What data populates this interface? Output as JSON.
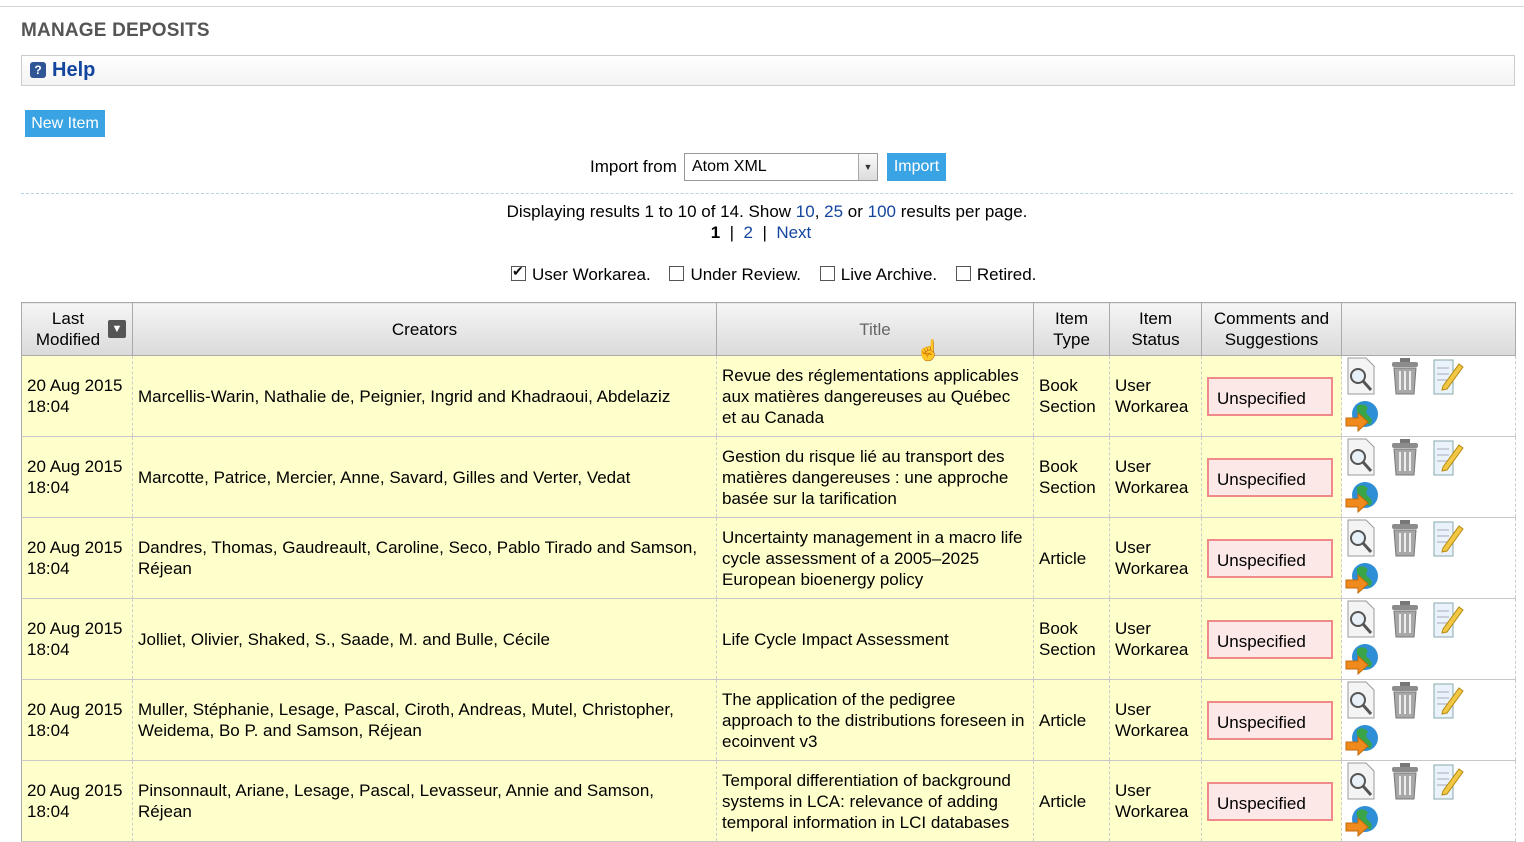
{
  "page": {
    "title": "MANAGE DEPOSITS",
    "help": "Help"
  },
  "toolbar": {
    "new_item": "New Item",
    "import_from": "Import from",
    "import_format": "Atom XML",
    "import_button": "Import"
  },
  "results": {
    "prefix": "Displaying results 1 to 10 of 14. Show ",
    "opt10": "10",
    "sep1": ", ",
    "opt25": "25",
    "sep2": " or ",
    "opt100": "100",
    "suffix": " results per page.",
    "current_page": "1",
    "page2": "2",
    "next": "Next",
    "divider": "|"
  },
  "filters": [
    {
      "label": "User Workarea.",
      "checked": true
    },
    {
      "label": "Under Review.",
      "checked": false
    },
    {
      "label": "Live Archive.",
      "checked": false
    },
    {
      "label": "Retired.",
      "checked": false
    }
  ],
  "columns": {
    "last_modified": "Last Modified",
    "creators": "Creators",
    "title": "Title",
    "item_type": "Item Type",
    "item_status": "Item Status",
    "comments": "Comments and Suggestions"
  },
  "rows": [
    {
      "date": "20 Aug 2015",
      "time": "18:04",
      "creators": "Marcellis-Warin, Nathalie de, Peignier, Ingrid and Khadraoui, Abdelaziz",
      "title": "Revue des réglementations applicables aux matières dangereuses au Québec et au Canada",
      "type": "Book Section",
      "status": "User Workarea",
      "comments": "Unspecified"
    },
    {
      "date": "20 Aug 2015",
      "time": "18:04",
      "creators": "Marcotte, Patrice, Mercier, Anne, Savard, Gilles and Verter, Vedat",
      "title": "Gestion du risque lié au transport des matières dangereuses : une approche basée sur la tarification",
      "type": "Book Section",
      "status": "User Workarea",
      "comments": "Unspecified"
    },
    {
      "date": "20 Aug 2015",
      "time": "18:04",
      "creators": "Dandres, Thomas, Gaudreault, Caroline, Seco, Pablo Tirado and Samson, Réjean",
      "title": "Uncertainty management in a macro life cycle assessment of a 2005–2025 European bioenergy policy",
      "type": "Article",
      "status": "User Workarea",
      "comments": "Unspecified"
    },
    {
      "date": "20 Aug 2015",
      "time": "18:04",
      "creators": "Jolliet, Olivier, Shaked, S., Saade, M. and Bulle, Cécile",
      "title": "Life Cycle Impact Assessment",
      "type": "Book Section",
      "status": "User Workarea",
      "comments": "Unspecified"
    },
    {
      "date": "20 Aug 2015",
      "time": "18:04",
      "creators": "Muller, Stéphanie, Lesage, Pascal, Ciroth, Andreas, Mutel, Christopher, Weidema, Bo P. and Samson, Réjean",
      "title": "The application of the pedigree approach to the distributions foreseen in ecoinvent v3",
      "type": "Article",
      "status": "User Workarea",
      "comments": "Unspecified"
    },
    {
      "date": "20 Aug 2015",
      "time": "18:04",
      "creators": "Pinsonnault, Ariane, Lesage, Pascal, Levasseur, Annie and Samson, Réjean",
      "title": "Temporal differentiation of background systems in LCA: relevance of adding temporal information in LCI databases",
      "type": "Article",
      "status": "User Workarea",
      "comments": "Unspecified"
    }
  ],
  "actions": [
    "view-icon",
    "delete-icon",
    "edit-icon",
    "deposit-icon"
  ],
  "colors": {
    "accent": "#3aa3e3",
    "link": "#1446a0",
    "row_bg": "#ffffcc",
    "unspecified_border": "#f08a8a"
  }
}
